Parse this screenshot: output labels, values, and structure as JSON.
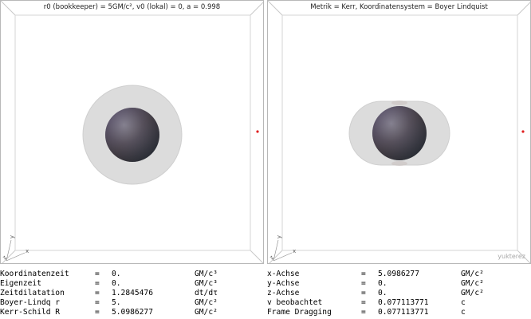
{
  "left_view": {
    "title": "r0 (bookkeeper) = 5GM/c², v0 (lokal) = 0, a = 0.998",
    "axis_x": "x",
    "axis_y": "y",
    "axis_z": "z"
  },
  "right_view": {
    "title": "Metrik = Kerr, Koordinatensystem = Boyer Lindquist",
    "axis_x": "x",
    "axis_y": "y",
    "axis_z": "z",
    "watermark": "yukterez"
  },
  "colors": {
    "panel_border": "#b8b8b8",
    "edge_lines": "#c8c8c8",
    "halo": "#dcdcdc",
    "marker": "#e02020"
  },
  "readout_left": [
    {
      "label": "Koordinatenzeit",
      "eq": "=",
      "value": "0.",
      "unit": "GM/c³"
    },
    {
      "label": "Eigenzeit",
      "eq": "=",
      "value": "0.",
      "unit": "GM/c³"
    },
    {
      "label": "Zeitdilatation",
      "eq": "=",
      "value": "1.2845476",
      "unit": "dt/dτ"
    },
    {
      "label": "Boyer-Lindq r",
      "eq": "=",
      "value": "5.",
      "unit": "GM/c²"
    },
    {
      "label": "Kerr-Schild R",
      "eq": "=",
      "value": "5.0986277",
      "unit": "GM/c²"
    }
  ],
  "readout_right": [
    {
      "label": "x-Achse",
      "eq": "=",
      "value": "5.0986277",
      "unit": "GM/c²"
    },
    {
      "label": "y-Achse",
      "eq": "=",
      "value": "0.",
      "unit": "GM/c²"
    },
    {
      "label": "z-Achse",
      "eq": "=",
      "value": "0.",
      "unit": "GM/c²"
    },
    {
      "label": "v beobachtet",
      "eq": "=",
      "value": "0.077113771",
      "unit": "c"
    },
    {
      "label": "Frame Dragging",
      "eq": "=",
      "value": "0.077113771",
      "unit": "c"
    }
  ]
}
